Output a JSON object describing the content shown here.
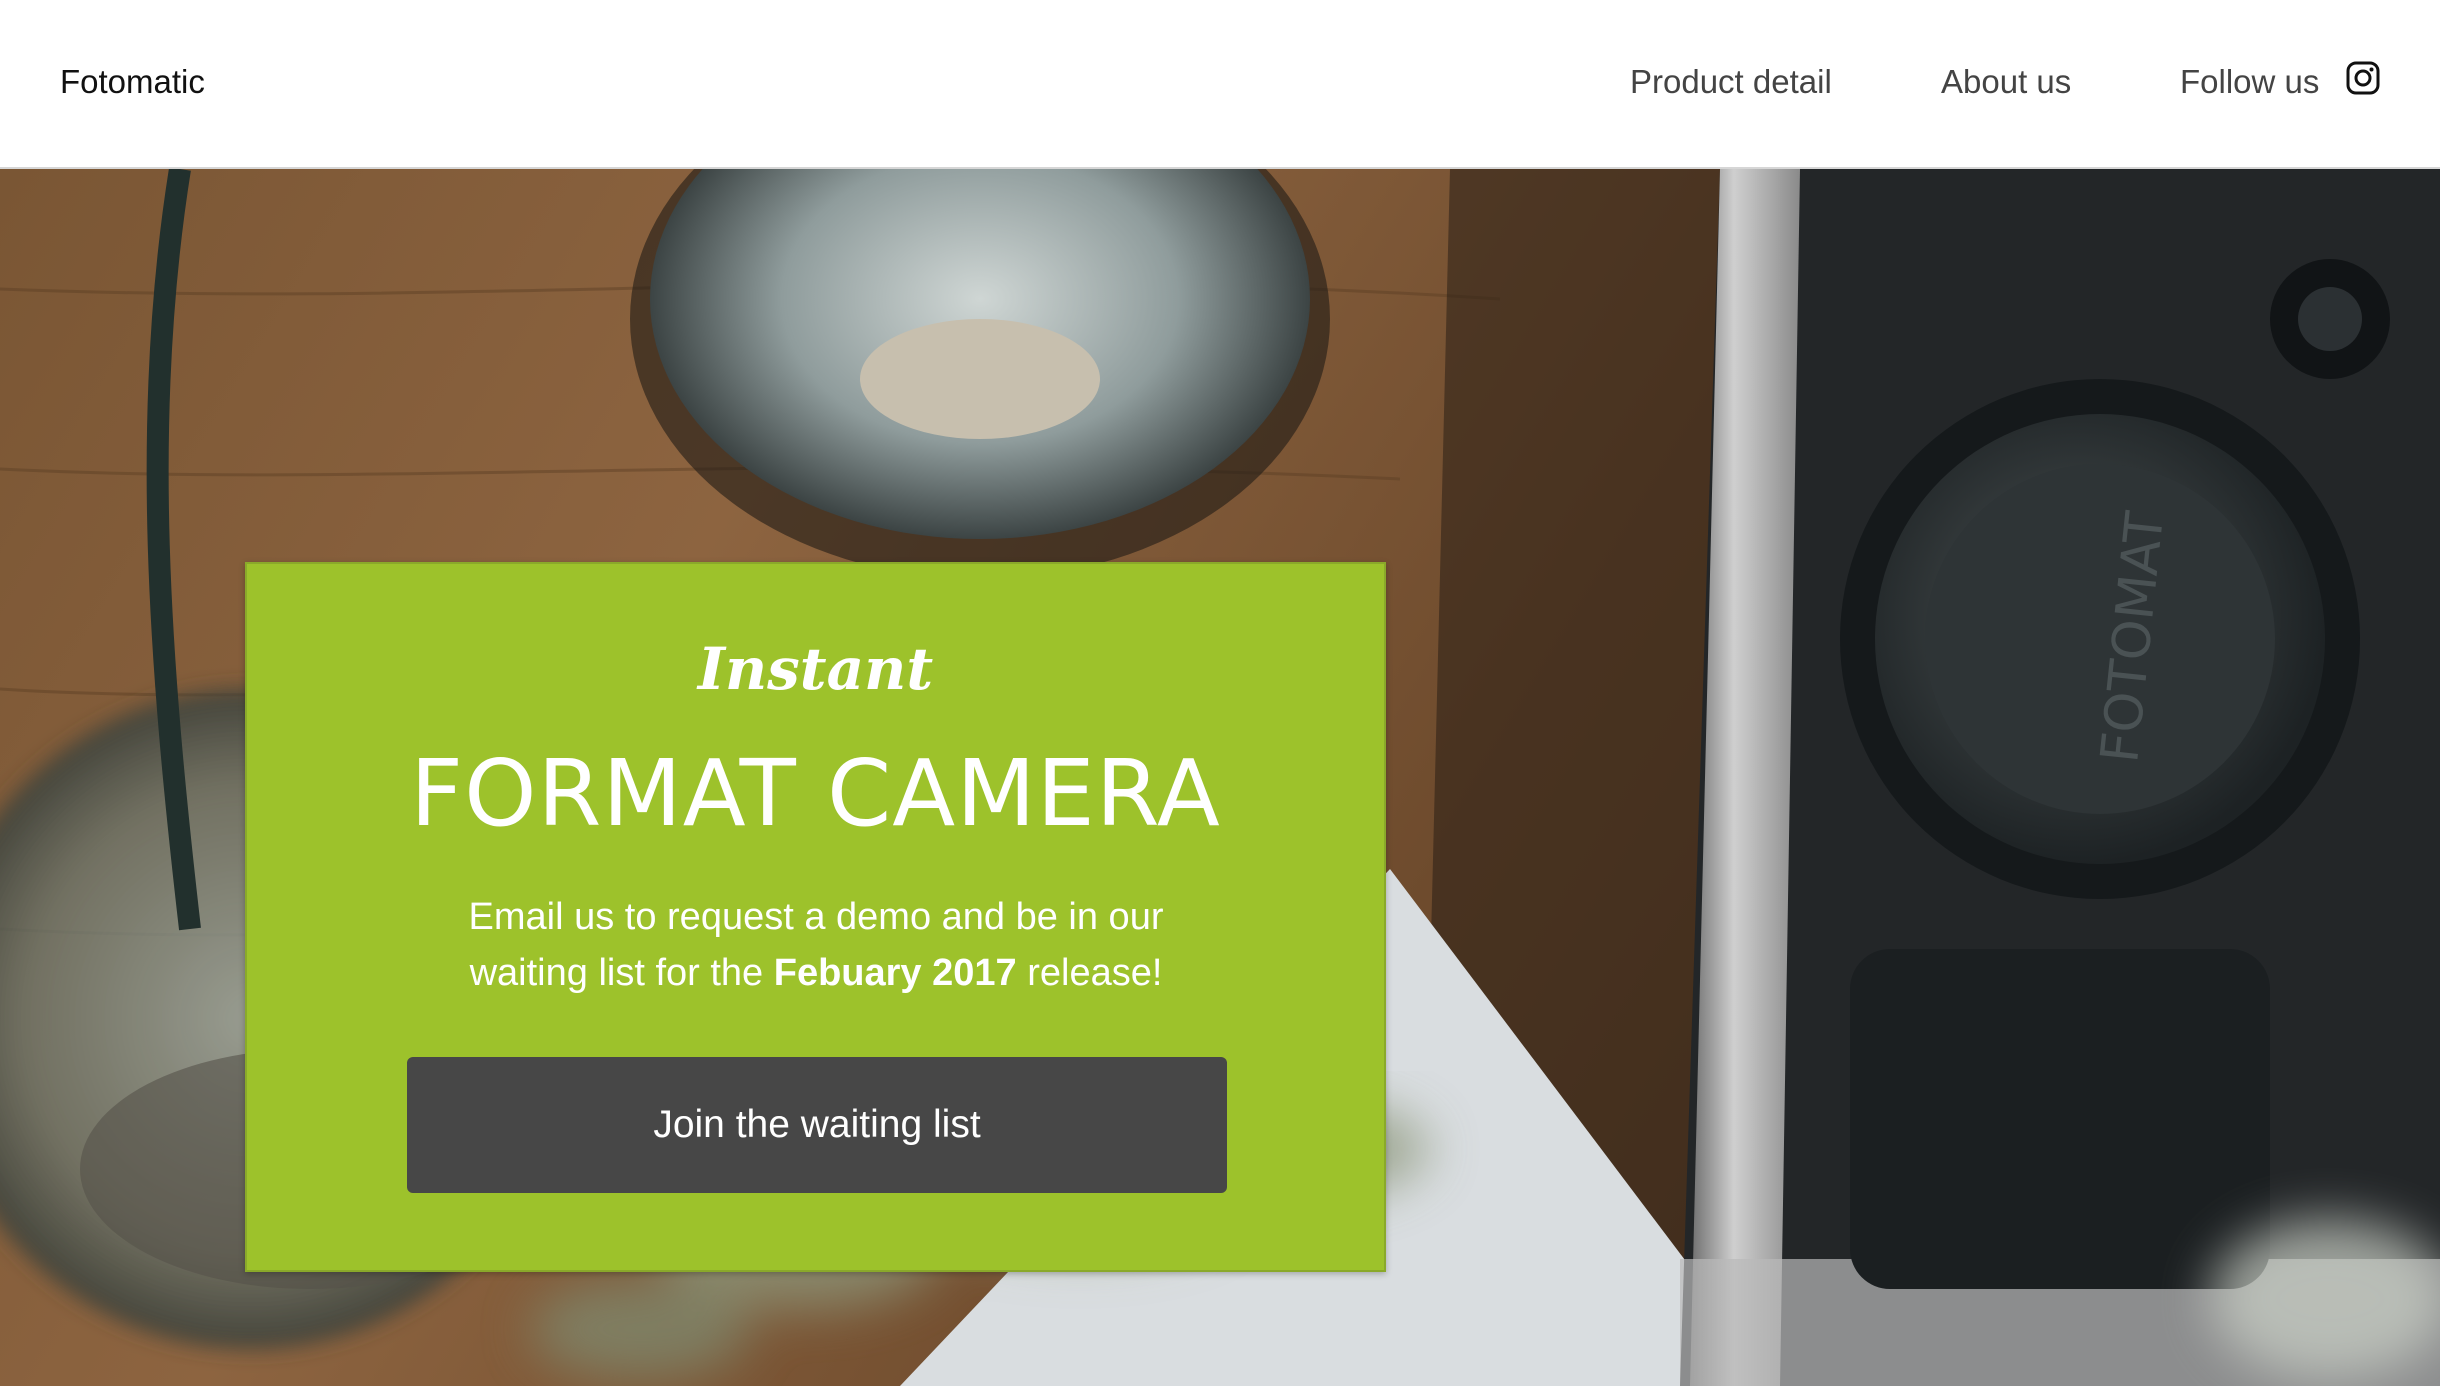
{
  "header": {
    "brand": "Fotomatic",
    "nav": {
      "product_detail": "Product detail",
      "about_us": "About us",
      "follow_us": "Follow us"
    },
    "social_icon": "instagram-icon"
  },
  "hero": {
    "background_image": "overhead photo of a vintage rangefinder camera on a wooden table",
    "camera_lens_cap_text": "FOTOMAT",
    "card": {
      "script_heading": "Instant",
      "title": "FORMAT CAMERA",
      "text_before": "Email us to request a demo and be in our waiting list for the ",
      "text_bold": "Febuary 2017",
      "text_after": " release!",
      "button_label": "Join the waiting list"
    }
  },
  "colors": {
    "card_background": "#9dc22b",
    "button_background": "#474747",
    "text_on_card": "#ffffff"
  }
}
